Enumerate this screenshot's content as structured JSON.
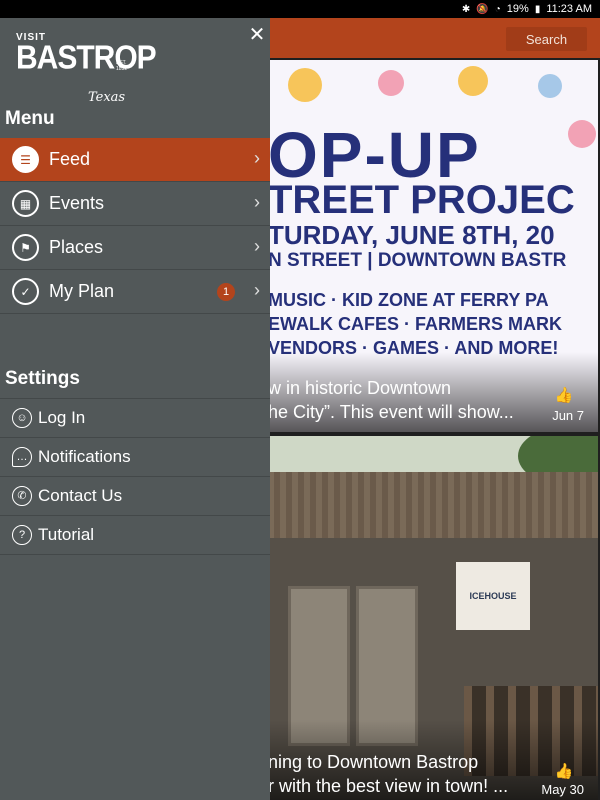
{
  "status_bar": {
    "battery": "19%",
    "time": "11:23 AM"
  },
  "topbar": {
    "search_label": "Search",
    "color": "#b3441c"
  },
  "drawer": {
    "logo": {
      "visit": "VISIT",
      "name": "BASTROP",
      "est": "EST. 1832",
      "state": "Texas"
    },
    "close_icon": "close-icon",
    "menu_heading": "Menu",
    "menu_items": [
      {
        "label": "Feed",
        "icon": "list-icon",
        "active": true
      },
      {
        "label": "Events",
        "icon": "calendar-icon",
        "active": false
      },
      {
        "label": "Places",
        "icon": "flag-icon",
        "active": false
      },
      {
        "label": "My Plan",
        "icon": "check-icon",
        "active": false,
        "badge": "1"
      }
    ],
    "settings_heading": "Settings",
    "settings_items": [
      {
        "label": "Log In",
        "icon": "user-icon"
      },
      {
        "label": "Notifications",
        "icon": "chat-bubble-icon"
      },
      {
        "label": "Contact Us",
        "icon": "phone-icon"
      },
      {
        "label": "Tutorial",
        "icon": "help-icon"
      }
    ]
  },
  "feed": {
    "cards": [
      {
        "poster_lines": [
          "OP-UP",
          "TREET PROJEC",
          "TURDAY, JUNE 8TH, 20",
          "N STREET | DOWNTOWN BASTR",
          "MUSIC · KID ZONE AT FERRY PA",
          "EWALK CAFES · FARMERS MARK",
          "VENDORS · GAMES · AND MORE!"
        ],
        "text_line1": "w in historic Downtown",
        "text_line2": "he City”. This event will show...",
        "date": "Jun 7"
      },
      {
        "sign_text": "ICEHOUSE",
        "text_line1": "ning to Downtown Bastrop",
        "text_line2": "r with the best view in town! ...",
        "date": "May 30"
      }
    ]
  }
}
